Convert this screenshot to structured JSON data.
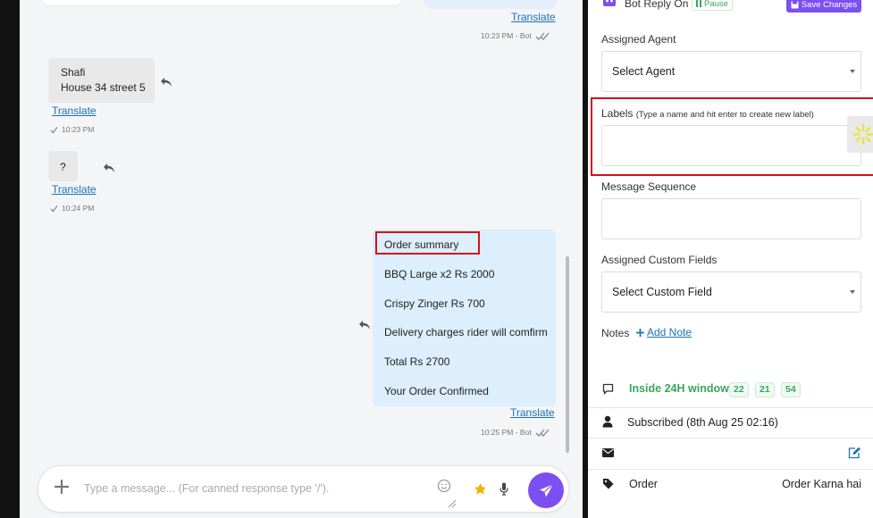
{
  "chat": {
    "messages": [
      {
        "translate": "Translate",
        "time": "10:23 PM - Bot"
      },
      {
        "lines": [
          "Shafi",
          "House 34 street 5"
        ],
        "translate": "Translate",
        "time": "10:23 PM"
      },
      {
        "text": "?",
        "translate": "Translate",
        "time": "10:24 PM"
      },
      {
        "lines": [
          "Order summary",
          "BBQ Large x2 Rs 2000",
          "Crispy Zinger Rs 700",
          "Delivery charges rider will comfirm",
          "Total Rs 2700",
          "Your Order Confirmed"
        ],
        "translate": "Translate",
        "time": "10:25 PM - Bot"
      }
    ],
    "composer": {
      "placeholder": "Type a message... (For canned response type '/')."
    }
  },
  "panel": {
    "bot_reply": "Bot Reply On",
    "pause": "Pause",
    "save": "Save Changes",
    "assigned_agent": {
      "label": "Assigned Agent",
      "value": "Select Agent"
    },
    "labels": {
      "label": "Labels",
      "hint": "(Type a name and hit enter to create new label)"
    },
    "message_sequence": {
      "label": "Message Sequence"
    },
    "custom_fields": {
      "label": "Assigned Custom Fields",
      "value": "Select Custom Field"
    },
    "notes": {
      "label": "Notes",
      "add": "Add Note"
    },
    "window": {
      "text": "Inside 24H window",
      "counts": [
        "22",
        "21",
        "54"
      ]
    },
    "subscribed": "Subscribed (8th Aug 25 02:16)",
    "order": {
      "label": "Order",
      "value": "Order Karna hai"
    }
  },
  "colors": {
    "accent": "#7b4ff0",
    "link": "#1a73b8",
    "highlight_box": "#d1121b",
    "green": "#3aa55d"
  }
}
